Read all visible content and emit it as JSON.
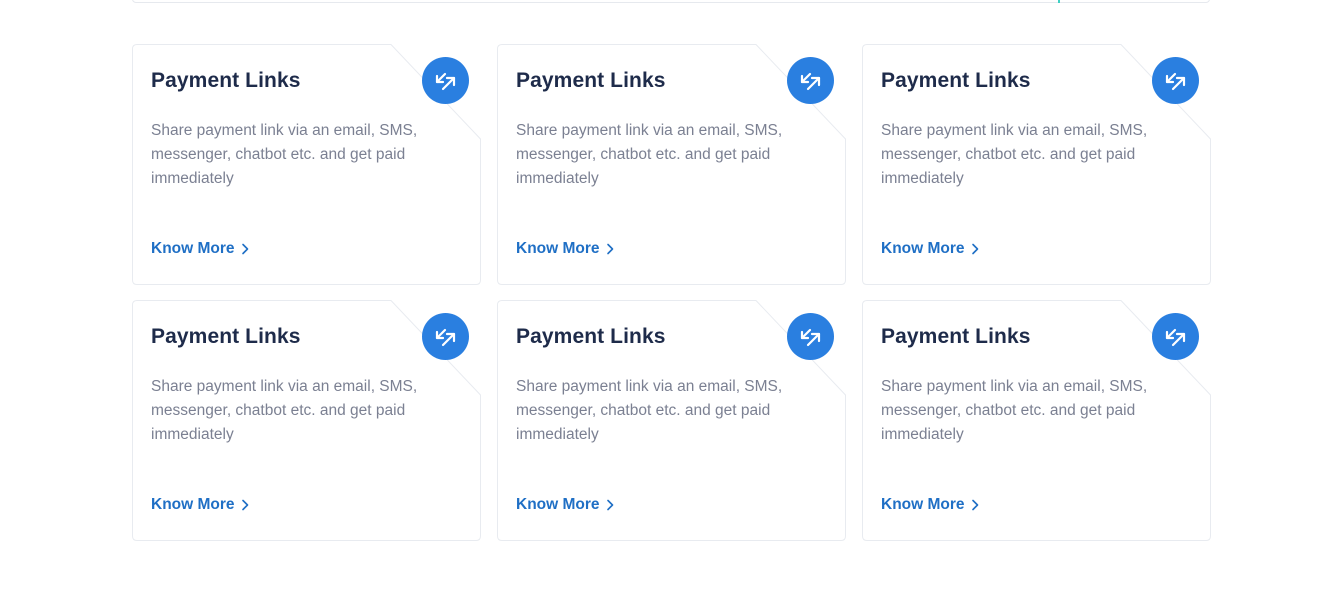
{
  "cards": [
    {
      "title": "Payment Links",
      "description": "Share payment link via an email, SMS, messenger, chatbot etc. and get paid immediately",
      "link": "Know More",
      "icon": "payment-link-arrows-icon"
    },
    {
      "title": "Payment Links",
      "description": "Share payment link via an email, SMS, messenger, chatbot etc. and get paid immediately",
      "link": "Know More",
      "icon": "payment-link-arrows-icon"
    },
    {
      "title": "Payment Links",
      "description": "Share payment link via an email, SMS, messenger, chatbot etc. and get paid immediately",
      "link": "Know More",
      "icon": "payment-link-arrows-icon"
    },
    {
      "title": "Payment Links",
      "description": "Share payment link via an email, SMS, messenger, chatbot etc. and get paid immediately",
      "link": "Know More",
      "icon": "payment-link-arrows-icon"
    },
    {
      "title": "Payment Links",
      "description": "Share payment link via an email, SMS, messenger, chatbot etc. and get paid immediately",
      "link": "Know More",
      "icon": "payment-link-arrows-icon"
    },
    {
      "title": "Payment Links",
      "description": "Share payment link via an email, SMS, messenger, chatbot etc. and get paid immediately",
      "link": "Know More",
      "icon": "payment-link-arrows-icon"
    }
  ],
  "colors": {
    "badge": "#2a7fe0",
    "title": "#1e2b4a",
    "description": "#7b8092",
    "link": "#1f6fc5",
    "card_border": "#e8ebf0"
  }
}
